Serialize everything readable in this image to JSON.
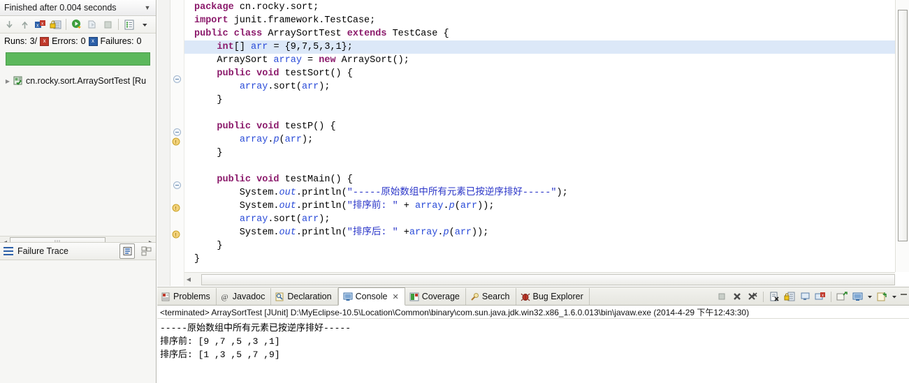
{
  "junit": {
    "title": "Finished after 0.004 seconds",
    "collapse_icon": "chevron-down-icon",
    "toolbar": [
      {
        "name": "next-failure-icon",
        "label": "Next Failure"
      },
      {
        "name": "previous-failure-icon",
        "label": "Previous Failure"
      },
      {
        "name": "show-failures-only-icon",
        "label": "Show Failures Only"
      },
      {
        "name": "scroll-lock-icon",
        "label": "Scroll Lock"
      },
      {
        "name": "rerun-test-icon",
        "label": "Rerun Test"
      },
      {
        "name": "rerun-failed-tests-icon",
        "label": "Rerun Test - Failures First"
      },
      {
        "name": "stop-icon",
        "label": "Stop JUnit Test Run"
      },
      {
        "name": "test-run-history-icon",
        "label": "Test Run History"
      },
      {
        "name": "view-menu-icon",
        "label": "View Menu"
      }
    ],
    "counts": {
      "runs_label": "Runs:",
      "runs_value": "3/",
      "errors_label": "Errors:",
      "errors_value": "0",
      "failures_label": "Failures:",
      "failures_value": "0"
    },
    "progress": {
      "percent": 100,
      "color": "#5cb85c"
    },
    "tree": [
      {
        "label": "cn.rocky.sort.ArraySortTest [Ru",
        "icon": "test-class-icon",
        "expander": "collapsed-arrow-icon"
      }
    ],
    "failure_trace": {
      "label": "Failure Trace",
      "icon": "failure-trace-icon",
      "tools": [
        {
          "name": "filter-stack-trace-icon"
        },
        {
          "name": "compare-result-icon"
        }
      ]
    },
    "scrollbar": {
      "name": "horizontal-scrollbar",
      "grip": "|||"
    }
  },
  "editor": {
    "lines": [
      {
        "indent": 0,
        "marker": "",
        "tokens": [
          {
            "t": "package",
            "c": "kw"
          },
          {
            "t": " cn.rocky.sort;",
            "c": ""
          }
        ]
      },
      {
        "indent": 0,
        "marker": "",
        "tokens": [
          {
            "t": "import",
            "c": "kw"
          },
          {
            "t": " junit.framework.TestCase;",
            "c": ""
          }
        ]
      },
      {
        "indent": 0,
        "marker": "",
        "tokens": [
          {
            "t": "public",
            "c": "kw"
          },
          {
            "t": " ",
            "c": ""
          },
          {
            "t": "class",
            "c": "kw"
          },
          {
            "t": " ArraySortTest ",
            "c": ""
          },
          {
            "t": "extends",
            "c": "kw"
          },
          {
            "t": " TestCase {",
            "c": ""
          }
        ]
      },
      {
        "indent": 1,
        "marker": "selected",
        "tokens": [
          {
            "t": "int",
            "c": "kw"
          },
          {
            "t": "[] ",
            "c": ""
          },
          {
            "t": "arr",
            "c": "fld"
          },
          {
            "t": " = {9,7,5,3,1};",
            "c": ""
          }
        ]
      },
      {
        "indent": 1,
        "marker": "",
        "tokens": [
          {
            "t": "ArraySort ",
            "c": ""
          },
          {
            "t": "array",
            "c": "fld"
          },
          {
            "t": " = ",
            "c": ""
          },
          {
            "t": "new",
            "c": "kw"
          },
          {
            "t": " ArraySort();",
            "c": ""
          }
        ]
      },
      {
        "indent": 1,
        "marker": "fold",
        "tokens": [
          {
            "t": "public",
            "c": "kw"
          },
          {
            "t": " ",
            "c": ""
          },
          {
            "t": "void",
            "c": "kw"
          },
          {
            "t": " testSort() {",
            "c": ""
          }
        ]
      },
      {
        "indent": 2,
        "marker": "",
        "tokens": [
          {
            "t": "array",
            "c": "fld"
          },
          {
            "t": ".sort(",
            "c": ""
          },
          {
            "t": "arr",
            "c": "fld"
          },
          {
            "t": ");",
            "c": ""
          }
        ]
      },
      {
        "indent": 1,
        "marker": "",
        "tokens": [
          {
            "t": "}",
            "c": ""
          }
        ]
      },
      {
        "indent": 0,
        "marker": "",
        "tokens": []
      },
      {
        "indent": 1,
        "marker": "fold",
        "tokens": [
          {
            "t": "public",
            "c": "kw"
          },
          {
            "t": " ",
            "c": ""
          },
          {
            "t": "void",
            "c": "kw"
          },
          {
            "t": " testP() {",
            "c": ""
          }
        ]
      },
      {
        "indent": 2,
        "marker": "warning",
        "tokens": [
          {
            "t": "array",
            "c": "fld"
          },
          {
            "t": ".",
            "c": ""
          },
          {
            "t": "p",
            "c": "stat"
          },
          {
            "t": "(",
            "c": ""
          },
          {
            "t": "arr",
            "c": "fld"
          },
          {
            "t": ");",
            "c": ""
          }
        ]
      },
      {
        "indent": 1,
        "marker": "",
        "tokens": [
          {
            "t": "}",
            "c": ""
          }
        ]
      },
      {
        "indent": 0,
        "marker": "",
        "tokens": []
      },
      {
        "indent": 1,
        "marker": "fold",
        "tokens": [
          {
            "t": "public",
            "c": "kw"
          },
          {
            "t": " ",
            "c": ""
          },
          {
            "t": "void",
            "c": "kw"
          },
          {
            "t": " testMain() {",
            "c": ""
          }
        ]
      },
      {
        "indent": 2,
        "marker": "",
        "tokens": [
          {
            "t": "System.",
            "c": ""
          },
          {
            "t": "out",
            "c": "stat"
          },
          {
            "t": ".println(",
            "c": ""
          },
          {
            "t": "\"-----原始数组中所有元素已按逆序排好-----\"",
            "c": "str"
          },
          {
            "t": ");",
            "c": ""
          }
        ]
      },
      {
        "indent": 2,
        "marker": "warning",
        "tokens": [
          {
            "t": "System.",
            "c": ""
          },
          {
            "t": "out",
            "c": "stat"
          },
          {
            "t": ".println(",
            "c": ""
          },
          {
            "t": "\"排序前: \"",
            "c": "str"
          },
          {
            "t": " + ",
            "c": ""
          },
          {
            "t": "array",
            "c": "fld"
          },
          {
            "t": ".",
            "c": ""
          },
          {
            "t": "p",
            "c": "stat"
          },
          {
            "t": "(",
            "c": ""
          },
          {
            "t": "arr",
            "c": "fld"
          },
          {
            "t": "));",
            "c": ""
          }
        ]
      },
      {
        "indent": 2,
        "marker": "",
        "tokens": [
          {
            "t": "array",
            "c": "fld"
          },
          {
            "t": ".sort(",
            "c": ""
          },
          {
            "t": "arr",
            "c": "fld"
          },
          {
            "t": ");",
            "c": ""
          }
        ]
      },
      {
        "indent": 2,
        "marker": "warning",
        "tokens": [
          {
            "t": "System.",
            "c": ""
          },
          {
            "t": "out",
            "c": "stat"
          },
          {
            "t": ".println(",
            "c": ""
          },
          {
            "t": "\"排序后: \"",
            "c": "str"
          },
          {
            "t": " +",
            "c": ""
          },
          {
            "t": "array",
            "c": "fld"
          },
          {
            "t": ".",
            "c": ""
          },
          {
            "t": "p",
            "c": "stat"
          },
          {
            "t": "(",
            "c": ""
          },
          {
            "t": "arr",
            "c": "fld"
          },
          {
            "t": "));",
            "c": ""
          }
        ]
      },
      {
        "indent": 1,
        "marker": "",
        "tokens": [
          {
            "t": "}",
            "c": ""
          }
        ]
      },
      {
        "indent": 0,
        "marker": "",
        "tokens": [
          {
            "t": "}",
            "c": ""
          }
        ]
      }
    ],
    "scrollbars": {
      "vertical": "vertical-scrollbar",
      "horizontal": "horizontal-scrollbar"
    }
  },
  "console": {
    "tabs": [
      {
        "label": "Problems",
        "icon": "problems-icon",
        "active": false,
        "closable": false
      },
      {
        "label": "Javadoc",
        "icon": "javadoc-icon",
        "active": false,
        "closable": false
      },
      {
        "label": "Declaration",
        "icon": "declaration-icon",
        "active": false,
        "closable": false
      },
      {
        "label": "Console",
        "icon": "console-icon",
        "active": true,
        "closable": true
      },
      {
        "label": "Coverage",
        "icon": "coverage-icon",
        "active": false,
        "closable": false
      },
      {
        "label": "Search",
        "icon": "search-icon",
        "active": false,
        "closable": false
      },
      {
        "label": "Bug Explorer",
        "icon": "bug-explorer-icon",
        "active": false,
        "closable": false
      }
    ],
    "toolbar": [
      {
        "name": "terminate-icon"
      },
      {
        "name": "remove-launch-icon"
      },
      {
        "name": "remove-all-terminated-icon"
      },
      {
        "name": "clear-console-icon"
      },
      {
        "name": "scroll-lock-icon"
      },
      {
        "name": "show-console-on-output-icon"
      },
      {
        "name": "show-console-on-error-icon"
      },
      {
        "name": "pin-console-icon"
      },
      {
        "name": "display-selected-console-icon"
      },
      {
        "name": "display-selected-console-dropdown-icon"
      },
      {
        "name": "open-console-icon"
      },
      {
        "name": "open-console-dropdown-icon"
      },
      {
        "name": "minimize-icon"
      }
    ],
    "terminated_line": "<terminated> ArraySortTest [JUnit] D:\\MyEclipse-10.5\\Location\\Common\\binary\\com.sun.java.jdk.win32.x86_1.6.0.013\\bin\\javaw.exe (2014-4-29 下午12:43:30)",
    "output": "-----原始数组中所有元素已按逆序排好-----\n排序前: [9 ,7 ,5 ,3 ,1]\n排序后: [1 ,3 ,5 ,7 ,9]"
  }
}
